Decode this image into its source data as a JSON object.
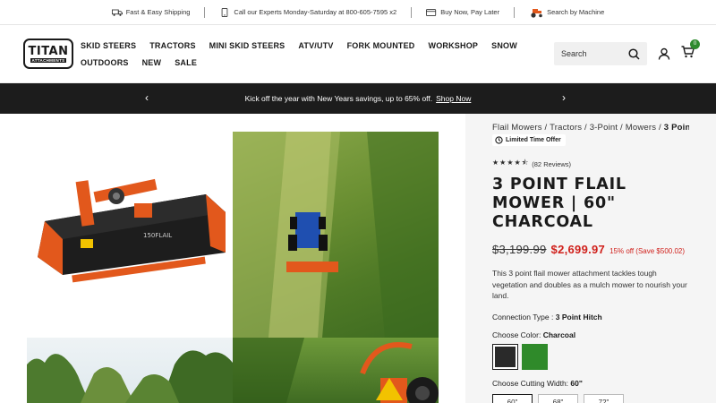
{
  "utility_bar": {
    "items": [
      {
        "label": "Fast & Easy Shipping",
        "icon": "truck-icon"
      },
      {
        "label": "Call our Experts Monday-Saturday at 800-605-7595 x2",
        "icon": "phone-icon"
      },
      {
        "label": "Buy Now, Pay Later",
        "icon": "credit-card-icon"
      },
      {
        "label": "Search by Machine",
        "icon": "tractor-icon"
      }
    ]
  },
  "header": {
    "logo_main": "TITAN",
    "logo_sub": "ATTACHMENTS",
    "nav": [
      "SKID STEERS",
      "TRACTORS",
      "MINI SKID STEERS",
      "ATV/UTV",
      "FORK MOUNTED",
      "WORKSHOP",
      "SNOW",
      "OUTDOORS",
      "NEW",
      "SALE"
    ],
    "search_placeholder": "Search",
    "cart_count": "0"
  },
  "promo": {
    "text": "Kick off the year with New Years savings, up to 65% off.",
    "link": "Shop Now",
    "prev_arrow": "‹",
    "next_arrow": "›"
  },
  "product": {
    "breadcrumb": [
      "Flail Mowers",
      "Tractors",
      "3-Point",
      "Mowers"
    ],
    "breadcrumb_current": "3 Point",
    "badge": "Limited Time Offer",
    "stars": "★★★★⯪",
    "reviews": "(82 Reviews)",
    "title": "3 Point Flail Mower | 60\" Charcoal",
    "old_price": "$3,199.99",
    "new_price": "$2,699.97",
    "save_text": "15% off (Save $500.02)",
    "description": "This 3 point flail mower attachment tackles tough vegetation and doubles as a mulch mower to nourish your land.",
    "connection_label": "Connection Type :",
    "connection_value": "3 Point Hitch",
    "color_label": "Choose Color:",
    "color_value": "Charcoal",
    "colors": [
      {
        "name": "Charcoal",
        "hex": "#2a2a2a"
      },
      {
        "name": "Green",
        "hex": "#2f8a2a"
      }
    ],
    "width_label": "Choose Cutting Width:",
    "width_value": "60\"",
    "widths": [
      "60\"",
      "68\"",
      "72\""
    ],
    "decal_text": "150FLAIL"
  },
  "colors": {
    "accent_red": "#d0211c",
    "promo_bg": "#1c1c1c",
    "cart_badge": "#2e8b2e",
    "mower_orange": "#e2581c"
  }
}
